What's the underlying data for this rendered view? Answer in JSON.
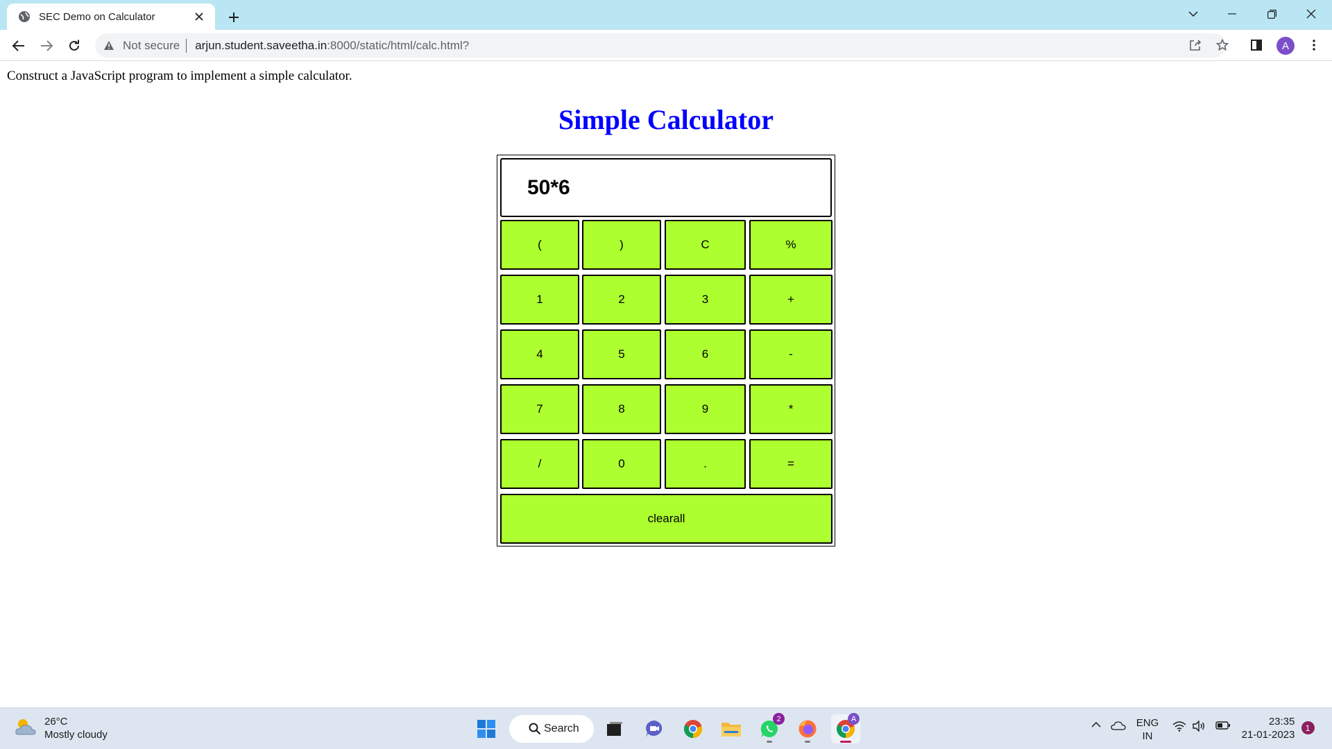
{
  "browser": {
    "tab_title": "SEC Demo on Calculator",
    "security_label": "Not secure",
    "url_host": "arjun.student.saveetha.in",
    "url_path": ":8000/static/html/calc.html?",
    "profile_initial": "A"
  },
  "page": {
    "instruction": "Construct a JavaScript program to implement a simple calculator.",
    "title": "Simple Calculator",
    "display_value": "50*6",
    "keys": [
      "(",
      ")",
      "C",
      "%",
      "1",
      "2",
      "3",
      "+",
      "4",
      "5",
      "6",
      "-",
      "7",
      "8",
      "9",
      "*",
      "/",
      "0",
      ".",
      "="
    ],
    "clear_all_label": "clearall"
  },
  "taskbar": {
    "temperature": "26°C",
    "weather": "Mostly cloudy",
    "search_label": "Search",
    "whatsapp_badge": "2",
    "language": "ENG",
    "region": "IN",
    "time": "23:35",
    "date": "21-01-2023",
    "notification_count": "1"
  },
  "colors": {
    "title_blue": "#0000ff",
    "key_green": "#adff2f",
    "tabstrip": "#b9e6f2"
  }
}
